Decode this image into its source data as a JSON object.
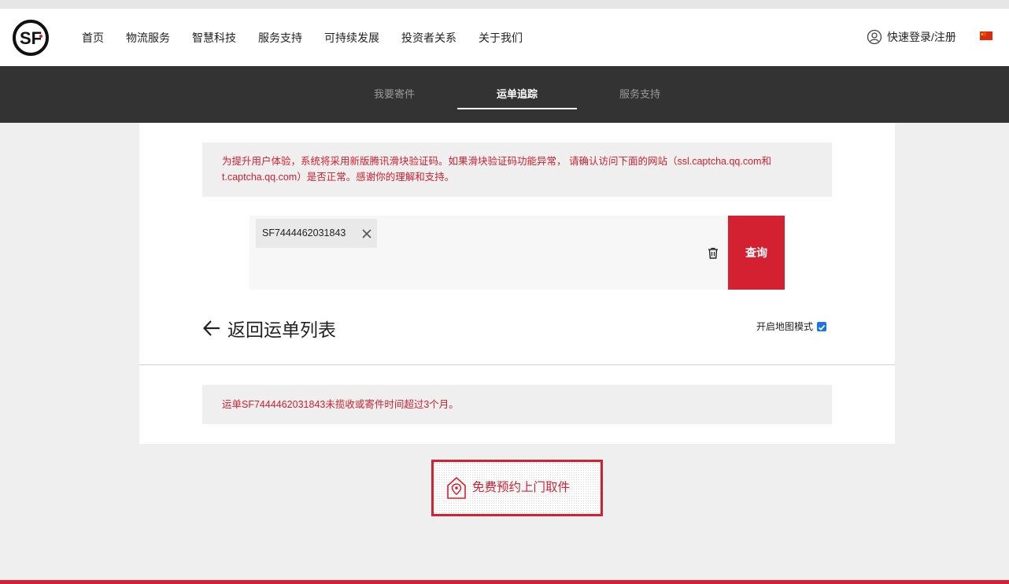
{
  "header": {
    "nav": [
      "首页",
      "物流服务",
      "智慧科技",
      "服务支持",
      "可持续发展",
      "投资者关系",
      "关于我们"
    ],
    "login_label": "快速登录/注册"
  },
  "subnav": {
    "tabs": [
      "我要寄件",
      "运单追踪",
      "服务支持"
    ],
    "active": "运单追踪"
  },
  "notice": {
    "text": "为提升用户体验，系统将采用新版腾讯滑块验证码。如果滑块验证码功能异常， 请确认访问下面的网站（ssl.captcha.qq.com和t.captcha.qq.com）是否正常。感谢你的理解和支持。"
  },
  "search": {
    "chip_value": "SF7444462031843",
    "query_label": "查询"
  },
  "back_label": "返回运单列表",
  "map_mode": {
    "label": "开启地图模式",
    "checked": true
  },
  "result_text": "运单SF7444462031843未揽收或寄件时间超过3个月。",
  "pickup_label": "免费预约上门取件",
  "colors": {
    "brand_red": "#d42131",
    "dark_bar": "#333333",
    "notice_text": "#d0212f"
  }
}
